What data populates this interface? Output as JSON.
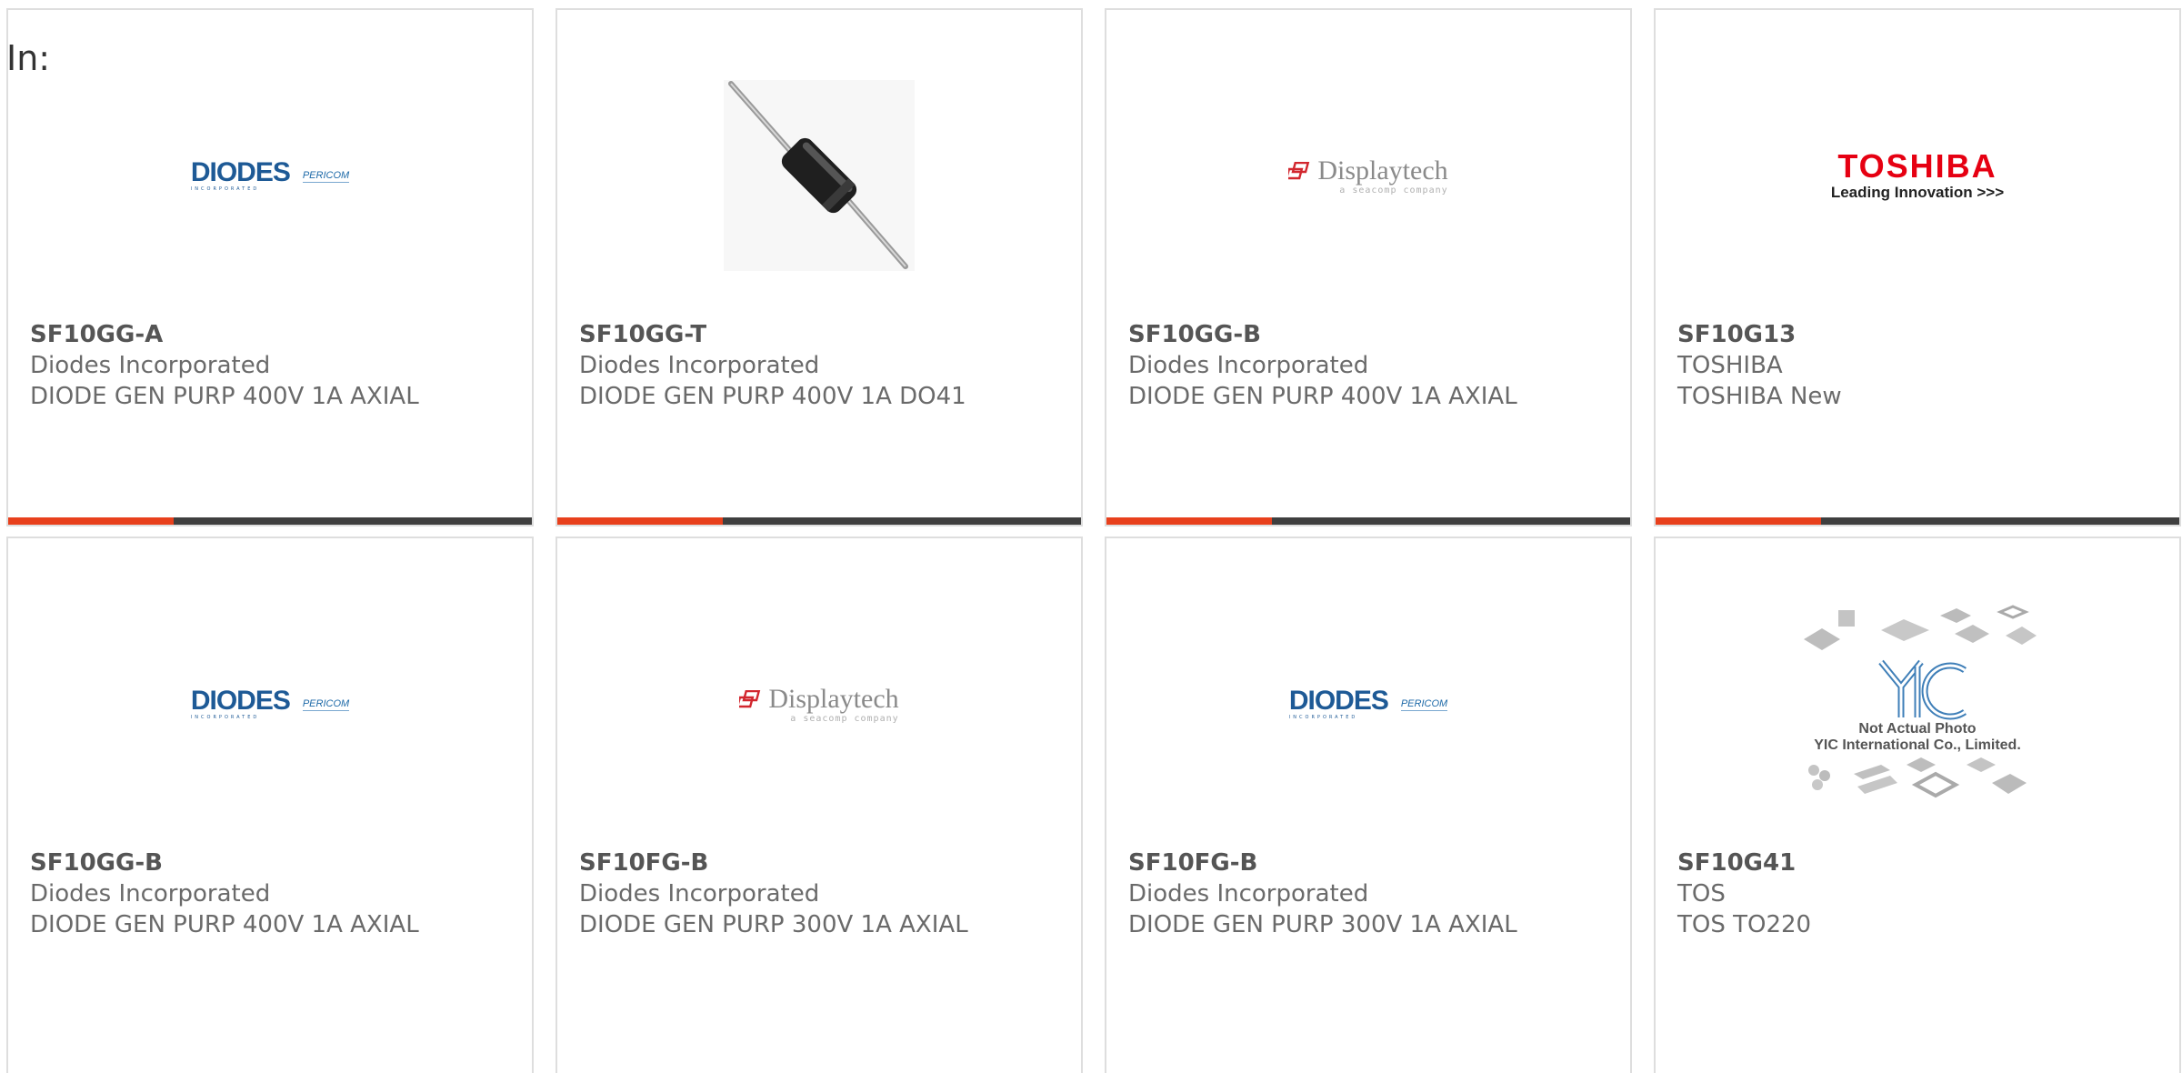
{
  "page": {
    "in_label": "In:"
  },
  "colors": {
    "accent": "#e8401c",
    "bar_dark": "#3f3f3f",
    "card_border": "#dedede",
    "text": "#666666"
  },
  "products": [
    {
      "part_number": "SF10GG-A",
      "manufacturer": "Diodes Incorporated",
      "description": "DIODE GEN PURP 400V 1A AXIAL",
      "image": "diodes-logo",
      "logo_text": "DIODES",
      "logo_sub": "INCORPORATED",
      "logo_partner": "PERICOM"
    },
    {
      "part_number": "SF10GG-T",
      "manufacturer": "Diodes Incorporated",
      "description": "DIODE GEN PURP 400V 1A DO41",
      "image": "axial-diode-photo"
    },
    {
      "part_number": "SF10GG-B",
      "manufacturer": "Diodes Incorporated",
      "description": "DIODE GEN PURP 400V 1A AXIAL",
      "image": "displaytech-logo",
      "logo_text": "Displaytech",
      "logo_sub": "a seacomp company"
    },
    {
      "part_number": "SF10G13",
      "manufacturer": "TOSHIBA",
      "description": "TOSHIBA New",
      "image": "toshiba-logo",
      "logo_text": "TOSHIBA",
      "logo_sub": "Leading Innovation >>>"
    },
    {
      "part_number": "SF10GG-B",
      "manufacturer": "Diodes Incorporated",
      "description": "DIODE GEN PURP 400V 1A AXIAL",
      "image": "diodes-logo",
      "logo_text": "DIODES",
      "logo_sub": "INCORPORATED",
      "logo_partner": "PERICOM"
    },
    {
      "part_number": "SF10FG-B",
      "manufacturer": "Diodes Incorporated",
      "description": "DIODE GEN PURP 300V 1A AXIAL",
      "image": "displaytech-logo",
      "logo_text": "Displaytech",
      "logo_sub": "a seacomp company"
    },
    {
      "part_number": "SF10FG-B",
      "manufacturer": "Diodes Incorporated",
      "description": "DIODE GEN PURP 300V 1A AXIAL",
      "image": "diodes-logo",
      "logo_text": "DIODES",
      "logo_sub": "INCORPORATED",
      "logo_partner": "PERICOM"
    },
    {
      "part_number": "SF10G41",
      "manufacturer": "TOS",
      "description": "TOS TO220",
      "image": "yic-placeholder",
      "logo_text": "YIC",
      "caption_line1": "Not Actual Photo",
      "caption_line2": "YIC International Co., Limited."
    }
  ]
}
